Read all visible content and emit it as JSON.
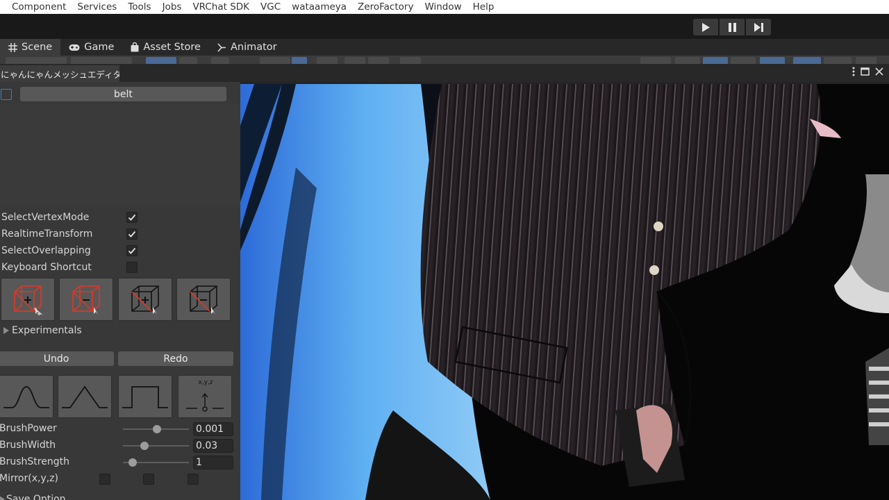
{
  "menu": [
    "Component",
    "Services",
    "Tools",
    "Jobs",
    "VRChat SDK",
    "VGC",
    "wataameya",
    "ZeroFactory",
    "Window",
    "Help"
  ],
  "tabs": [
    {
      "label": "Scene",
      "icon": "grid-icon"
    },
    {
      "label": "Game",
      "icon": "gamepad-icon"
    },
    {
      "label": "Asset Store",
      "icon": "shopping-bag-icon"
    },
    {
      "label": "Animator",
      "icon": "animator-icon"
    }
  ],
  "editor": {
    "title": "にゃんにゃんメッシュエディター",
    "mesh_name": "belt",
    "options": [
      {
        "label": "SelectVertexMode",
        "checked": true
      },
      {
        "label": "RealtimeTransform",
        "checked": true
      },
      {
        "label": "SelectOverlapping",
        "checked": true
      },
      {
        "label": "Keyboard Shortcut",
        "checked": false
      }
    ],
    "experimentals_label": "Experimentals",
    "undo_label": "Undo",
    "redo_label": "Redo",
    "brush_axis_label": "x,y,z",
    "sliders": [
      {
        "label": "BrushPower",
        "value": "0.001"
      },
      {
        "label": "BrushWidth",
        "value": "0.03"
      },
      {
        "label": "BrushStrength",
        "value": "1"
      }
    ],
    "mirror_label": "Mirror(x,y,z)",
    "save_option_label": "Save Option"
  },
  "colors": {
    "accent": "#3f7ec9",
    "panel": "#383838",
    "button": "#585858",
    "red_icon": "#d23a2a"
  }
}
